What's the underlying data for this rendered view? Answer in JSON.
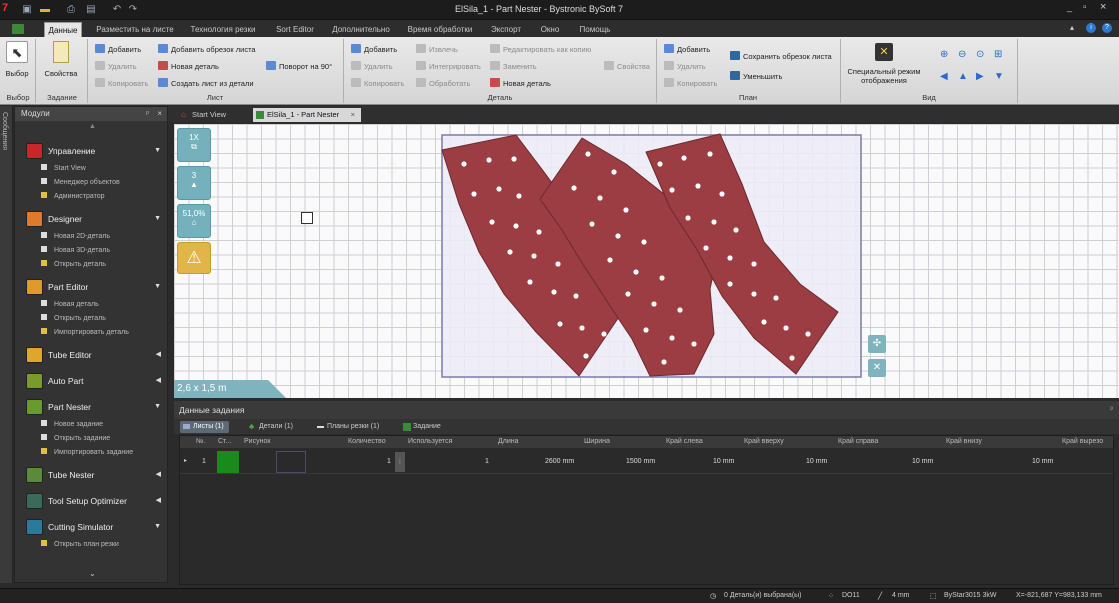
{
  "window": {
    "title": "ElSila_1 - Part Nester - Bystronic BySoft 7",
    "app_logo": "7",
    "controls": [
      "_",
      "▫",
      "×"
    ]
  },
  "ribbon_tabs": [
    "Данные",
    "Разместить на листе",
    "Технология резки",
    "Sort Editor",
    "Дополнительно",
    "Время обработки",
    "Экспорт",
    "Окно",
    "Помощь"
  ],
  "ribbon": {
    "groups": {
      "vybor": "Выбор",
      "zadanie": "Задание",
      "list": "Лист",
      "detal": "Деталь",
      "plan": "План",
      "vid": "Вид"
    },
    "vybor_btn": "Выбор",
    "svoistva_btn": "Свойства",
    "list": {
      "dobavit": "Добавить",
      "udalit": "Удалить",
      "kopirovat": "Копировать",
      "dobavit_obrezok": "Добавить обрезок листа",
      "novaya_detal": "Новая деталь",
      "sozdat_list": "Создать лист из детали",
      "povorot": "Поворот на 90°"
    },
    "detal": {
      "dobavit": "Добавить",
      "udalit": "Удалить",
      "kopirovat": "Копировать",
      "izvlech": "Извлечь",
      "integrirovat": "Интегрировать",
      "obrabotat": "Обработать",
      "redaktirovat": "Редактировать как копию",
      "zamenit": "Заменить",
      "novaya_detal": "Новая деталь",
      "svoistva": "Свойства"
    },
    "plan": {
      "dobavit": "Добавить",
      "udalit": "Удалить",
      "kopirovat": "Копировать",
      "sohranit": "Сохранить обрезок листа",
      "umenshit": "Уменьшить"
    },
    "vid": {
      "special_1": "Специальный режим",
      "special_2": "отображения"
    }
  },
  "sidebar_strip_label": "Сообщения",
  "modules": {
    "header": "Модули",
    "sections": [
      {
        "label": "Управление",
        "color": "#c8262a",
        "items": [
          "Start View",
          "Менеджер объектов",
          "Администратор"
        ]
      },
      {
        "label": "Designer",
        "color": "#e07a2a",
        "items": [
          "Новая 2D-деталь",
          "Новая 3D-деталь",
          "Открыть деталь"
        ]
      },
      {
        "label": "Part Editor",
        "color": "#e09a2a",
        "items": [
          "Новая деталь",
          "Открыть деталь",
          "Импортировать деталь"
        ]
      },
      {
        "label": "Tube Editor",
        "color": "#e0a52a",
        "items": []
      },
      {
        "label": "Auto Part",
        "color": "#7a9a2a",
        "items": []
      },
      {
        "label": "Part Nester",
        "color": "#6a9a2a",
        "items": [
          "Новое задание",
          "Открыть задание",
          "Импортировать задание"
        ]
      },
      {
        "label": "Tube Nester",
        "color": "#5a8a3a",
        "items": []
      },
      {
        "label": "Tool Setup Optimizer",
        "color": "#3a6a5a",
        "items": []
      },
      {
        "label": "Cutting Simulator",
        "color": "#2a7a9a",
        "items": [
          "Открыть план резки"
        ]
      }
    ]
  },
  "doc_tabs": [
    "Start View",
    "ElSila_1 - Part Nester"
  ],
  "canvas": {
    "tool_1x": "1X",
    "tool_count": "3",
    "tool_pct": "51,0%",
    "warning_icon": "warning-icon",
    "zoom_fit_icon": "zoom-fit-icon",
    "close_icon": "close-icon",
    "sheet_size": "2,6 x 1,5 m",
    "part_color": "#9b3d42",
    "sheet_color": "#ecebf7"
  },
  "bottom": {
    "title": "Данные задания",
    "tabs": [
      "Листы (1)",
      "Детали (1)",
      "Планы резки (1)",
      "Задание"
    ],
    "columns": [
      "№.",
      "Ст...",
      "Рисунок",
      "Количество",
      "Используется",
      "Длина",
      "Ширина",
      "Край слева",
      "Край вверху",
      "Край справа",
      "Край внизу",
      "Край вырезо"
    ],
    "row": {
      "num": "1",
      "status_color": "#1a8a1a",
      "qty": "1",
      "used": "1",
      "length": "2600 mm",
      "width": "1500 mm",
      "left": "10 mm",
      "top": "10 mm",
      "right": "10 mm",
      "bottom": "10 mm"
    }
  },
  "status": {
    "parts_selected": "0 Деталь(и) выбрана(ы)",
    "code": "DO11",
    "thickness": "4 mm",
    "machine": "ByStar3015 3kW",
    "coords": "X=-821,687  Y=983,133 mm"
  }
}
